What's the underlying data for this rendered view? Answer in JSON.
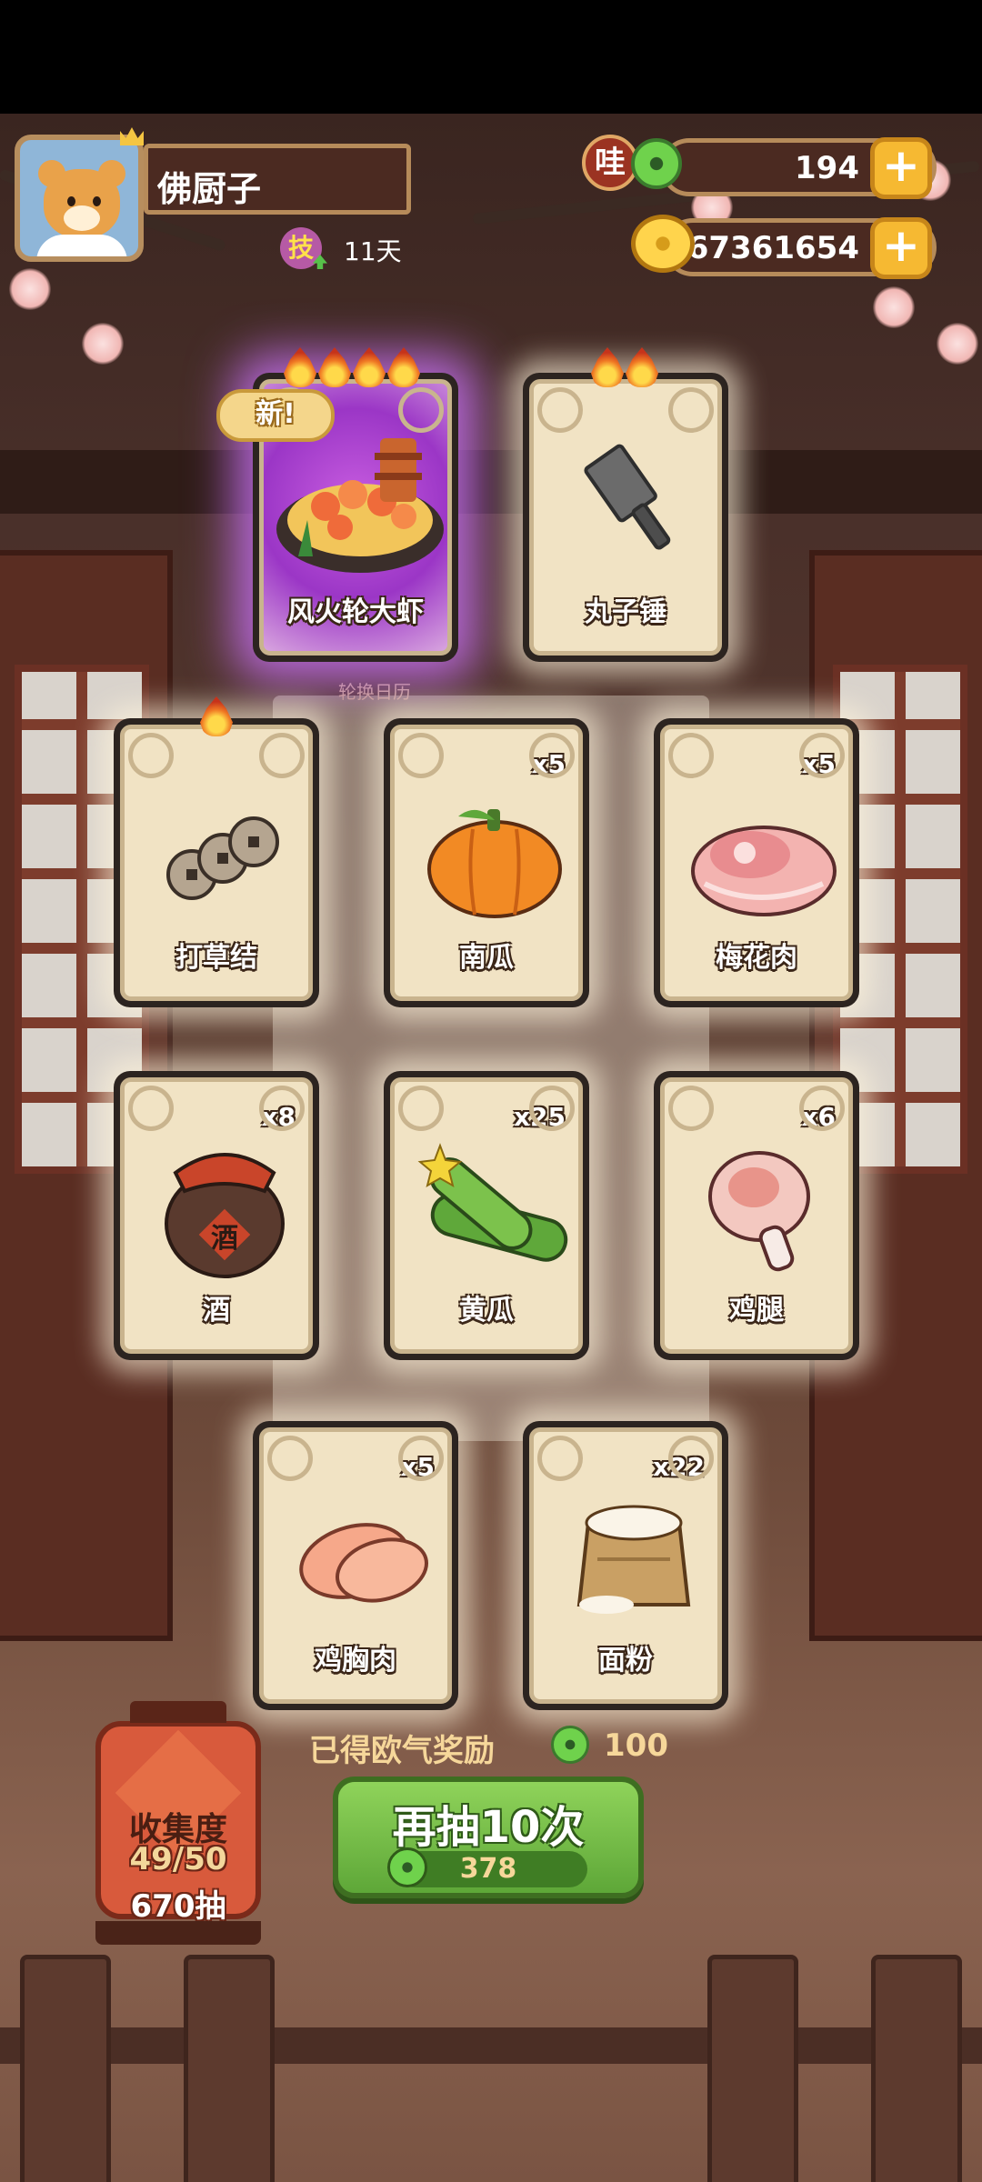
{
  "player": {
    "name": "佛厨子",
    "skill_icon_char": "技",
    "days": "11天"
  },
  "currencies": {
    "wa_icon_char": "哇",
    "jade_value": "194",
    "coin_value": "67361654",
    "plus_label": "+"
  },
  "featured": {
    "new_badge": "新!",
    "rotation_label": "轮换日历",
    "cards": [
      {
        "name": "风火轮大虾",
        "flames": 4
      },
      {
        "name": "丸子锤",
        "flames": 2
      }
    ]
  },
  "cards": [
    {
      "name": "打草结",
      "qty": ""
    },
    {
      "name": "南瓜",
      "qty": "x5"
    },
    {
      "name": "梅花肉",
      "qty": "x5"
    },
    {
      "name": "酒",
      "qty": "x8"
    },
    {
      "name": "黄瓜",
      "qty": "x25"
    },
    {
      "name": "鸡腿",
      "qty": "x6"
    },
    {
      "name": "鸡胸肉",
      "qty": "x5"
    },
    {
      "name": "面粉",
      "qty": "x22"
    }
  ],
  "jar_label": "酒",
  "collection": {
    "title": "收集度",
    "progress": "49/50",
    "draws": "670抽"
  },
  "reward": {
    "label": "已得欧气奖励",
    "value": "100"
  },
  "draw_button": {
    "label": "再抽10次",
    "cost": "378"
  },
  "colors": {
    "accent_green": "#5ea738",
    "gold": "#f6b932",
    "purple_glow": "#c46ef0",
    "card_bg": "#f1e3c4"
  }
}
